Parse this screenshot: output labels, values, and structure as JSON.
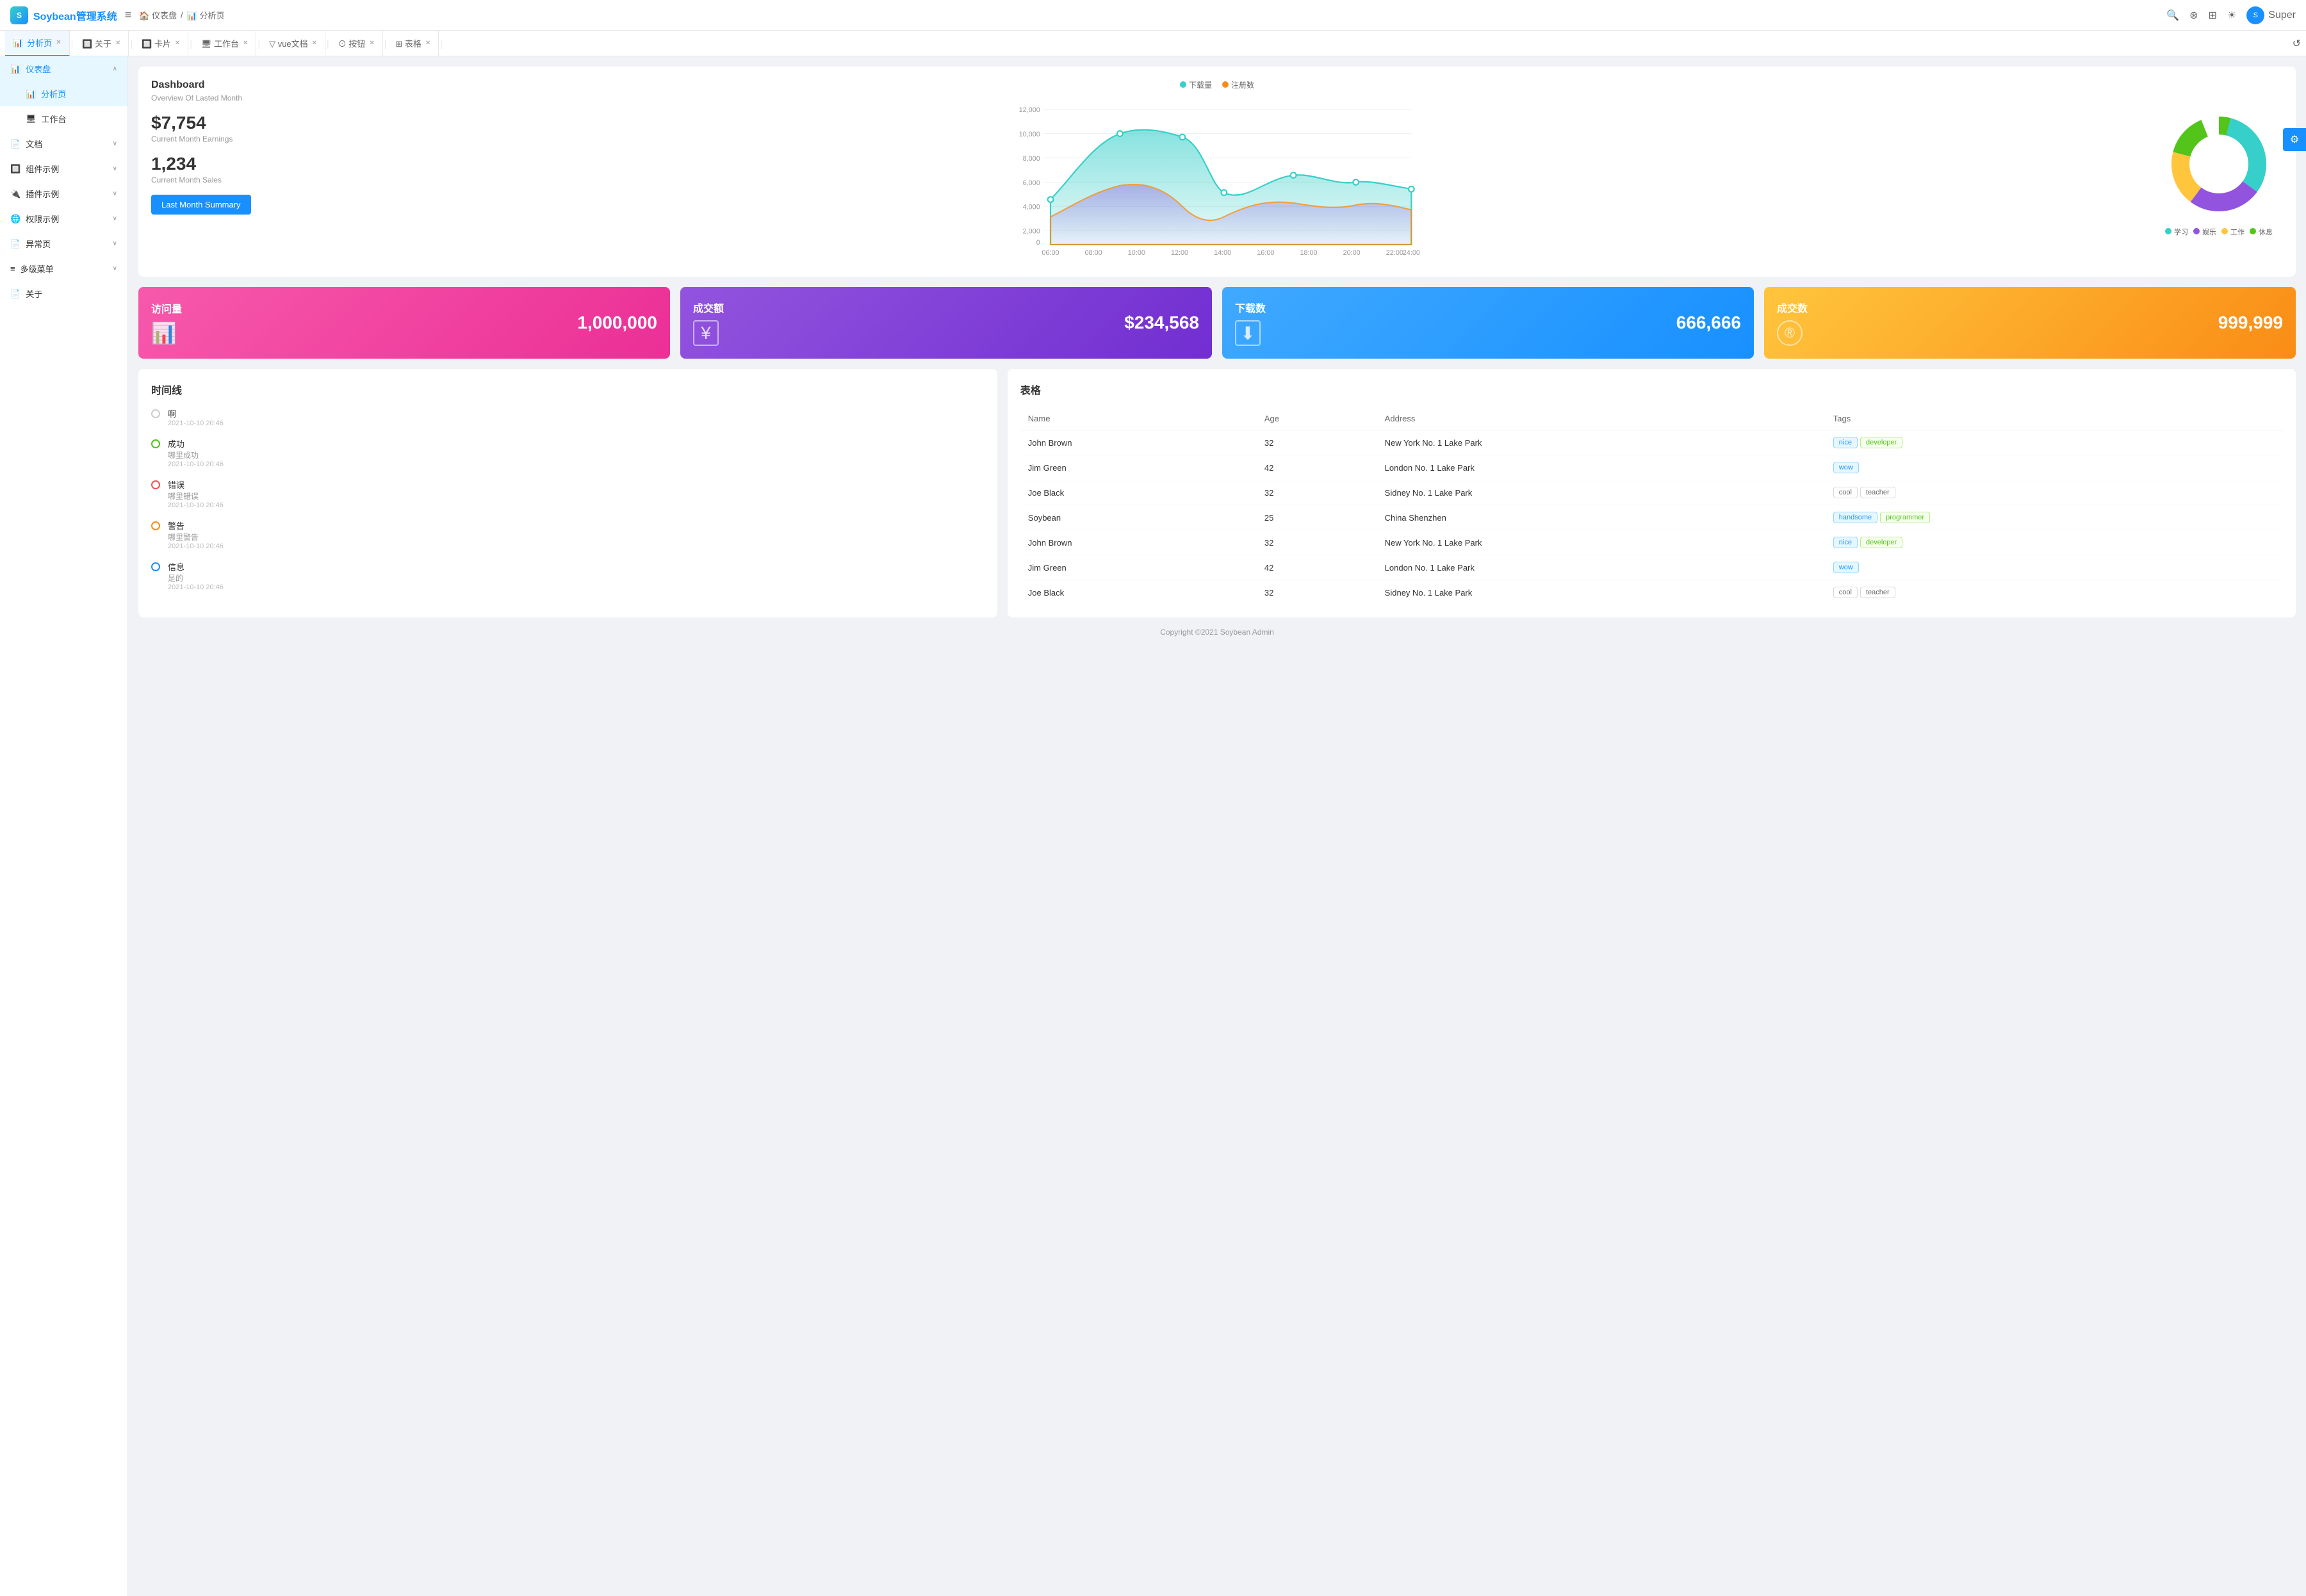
{
  "app": {
    "name": "Soybean管理系统",
    "breadcrumb": [
      "仪表盘",
      "分析页"
    ]
  },
  "nav": {
    "search_icon": "🔍",
    "github_icon": "⊞",
    "grid_icon": "⊞",
    "theme_icon": "☀",
    "user_name": "Super",
    "collapse_icon": "≡",
    "refresh_icon": "↺"
  },
  "tabs": [
    {
      "label": "分析页",
      "icon": "📊",
      "active": true,
      "closable": true
    },
    {
      "label": "关于",
      "icon": "🔲",
      "active": false,
      "closable": true
    },
    {
      "label": "卡片",
      "icon": "🔲",
      "active": false,
      "closable": true
    },
    {
      "label": "工作台",
      "icon": "🖥",
      "active": false,
      "closable": true
    },
    {
      "label": "vue文档",
      "icon": "▽",
      "active": false,
      "closable": true
    },
    {
      "label": "按钮",
      "icon": "⊙",
      "active": false,
      "closable": true
    },
    {
      "label": "表格",
      "icon": "⊞",
      "active": false,
      "closable": true
    }
  ],
  "sidebar": {
    "sections": [
      {
        "items": [
          {
            "label": "仪表盘",
            "icon": "📊",
            "active": true,
            "expandable": true,
            "expanded": true
          },
          {
            "label": "分析页",
            "icon": "📊",
            "active": true,
            "sub": true
          },
          {
            "label": "工作台",
            "icon": "🖥",
            "active": false,
            "sub": true
          }
        ]
      },
      {
        "items": [
          {
            "label": "文档",
            "icon": "📄",
            "expandable": true
          }
        ]
      },
      {
        "items": [
          {
            "label": "组件示例",
            "icon": "🔲",
            "expandable": true
          }
        ]
      },
      {
        "items": [
          {
            "label": "插件示例",
            "icon": "🔌",
            "expandable": true
          }
        ]
      },
      {
        "items": [
          {
            "label": "权限示例",
            "icon": "🌐",
            "expandable": true
          }
        ]
      },
      {
        "items": [
          {
            "label": "异常页",
            "icon": "📄",
            "expandable": true
          }
        ]
      },
      {
        "items": [
          {
            "label": "多级菜单",
            "icon": "≡",
            "expandable": true
          }
        ]
      },
      {
        "items": [
          {
            "label": "关于",
            "icon": "📄",
            "expandable": false
          }
        ]
      }
    ]
  },
  "dashboard": {
    "title": "Dashboard",
    "subtitle": "Overview Of Lasted Month",
    "earnings_value": "$7,754",
    "earnings_label": "Current Month Earnings",
    "sales_value": "1,234",
    "sales_label": "Current Month Sales",
    "button_label": "Last Month Summary",
    "chart_legend": [
      "下载量",
      "注册数"
    ],
    "donut_legend": [
      {
        "label": "学习",
        "color": "#36cfc9"
      },
      {
        "label": "娱乐",
        "color": "#9254de"
      },
      {
        "label": "工作",
        "color": "#ffc53d"
      },
      {
        "label": "休息",
        "color": "#52c41a"
      }
    ]
  },
  "stats": [
    {
      "label": "访问量",
      "value": "1,000,000",
      "icon": "📊",
      "color1": "#f759ab",
      "color2": "#eb2f96"
    },
    {
      "label": "成交额",
      "value": "$234,568",
      "icon": "¥",
      "color1": "#9254de",
      "color2": "#722ed1"
    },
    {
      "label": "下载数",
      "value": "666,666",
      "icon": "⬇",
      "color1": "#40a9ff",
      "color2": "#1890ff"
    },
    {
      "label": "成交数",
      "value": "999,999",
      "icon": "®",
      "color1": "#ffc53d",
      "color2": "#fa8c16"
    }
  ],
  "timeline": {
    "title": "时间线",
    "items": [
      {
        "label": "啊",
        "sub": "",
        "time": "2021-10-10 20:46",
        "type": "default"
      },
      {
        "label": "成功",
        "sub": "哪里成功",
        "time": "2021-10-10 20:46",
        "type": "green"
      },
      {
        "label": "错误",
        "sub": "哪里错误",
        "time": "2021-10-10 20:46",
        "type": "red"
      },
      {
        "label": "警告",
        "sub": "哪里警告",
        "time": "2021-10-10 20:46",
        "type": "orange"
      },
      {
        "label": "信息",
        "sub": "是的",
        "time": "2021-10-10 20:46",
        "type": "blue"
      }
    ]
  },
  "table": {
    "title": "表格",
    "columns": [
      "Name",
      "Age",
      "Address",
      "Tags"
    ],
    "rows": [
      {
        "name": "John Brown",
        "age": 32,
        "address": "New York No. 1 Lake Park",
        "tags": [
          {
            "label": "nice",
            "type": "blue"
          },
          {
            "label": "developer",
            "type": "green"
          }
        ]
      },
      {
        "name": "Jim Green",
        "age": 42,
        "address": "London No. 1 Lake Park",
        "tags": [
          {
            "label": "wow",
            "type": "blue"
          }
        ]
      },
      {
        "name": "Joe Black",
        "age": 32,
        "address": "Sidney No. 1 Lake Park",
        "tags": [
          {
            "label": "cool",
            "type": "default"
          },
          {
            "label": "teacher",
            "type": "default"
          }
        ]
      },
      {
        "name": "Soybean",
        "age": 25,
        "address": "China Shenzhen",
        "tags": [
          {
            "label": "handsome",
            "type": "blue"
          },
          {
            "label": "programmer",
            "type": "green"
          }
        ]
      },
      {
        "name": "John Brown",
        "age": 32,
        "address": "New York No. 1 Lake Park",
        "tags": [
          {
            "label": "nice",
            "type": "blue"
          },
          {
            "label": "developer",
            "type": "green"
          }
        ]
      },
      {
        "name": "Jim Green",
        "age": 42,
        "address": "London No. 1 Lake Park",
        "tags": [
          {
            "label": "wow",
            "type": "blue"
          }
        ]
      },
      {
        "name": "Joe Black",
        "age": 32,
        "address": "Sidney No. 1 Lake Park",
        "tags": [
          {
            "label": "cool",
            "type": "default"
          },
          {
            "label": "teacher",
            "type": "default"
          }
        ]
      }
    ]
  },
  "footer": {
    "text": "Copyright ©2021 Soybean Admin"
  }
}
